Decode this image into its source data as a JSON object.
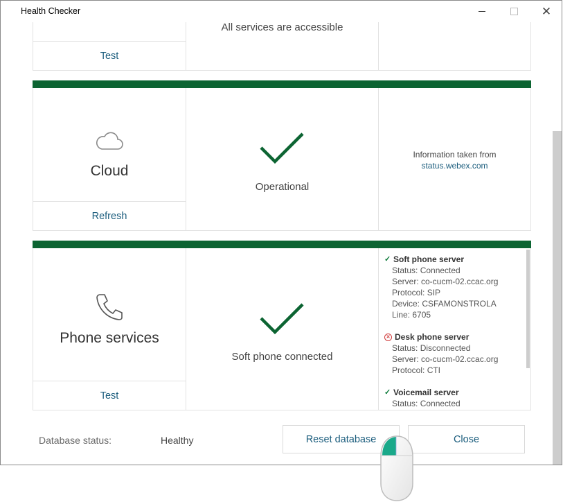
{
  "window": {
    "title": "Health Checker"
  },
  "cards": {
    "top": {
      "status": "All services are accessible",
      "action": "Test"
    },
    "cloud": {
      "name": "Cloud",
      "status": "Operational",
      "action": "Refresh",
      "info_prefix": "Information taken from",
      "info_link": "status.webex.com",
      "icon": "cloud-icon"
    },
    "phone": {
      "name": "Phone services",
      "status": "Soft phone connected",
      "action": "Test",
      "icon": "phone-icon",
      "details": [
        {
          "state": "ok",
          "title": "Soft phone server",
          "lines": [
            "Status: Connected",
            "Server: co-cucm-02.ccac.org",
            "Protocol: SIP",
            "Device: CSFAMONSTROLA",
            "Line: 6705"
          ]
        },
        {
          "state": "error",
          "title": "Desk phone server",
          "lines": [
            "Status: Disconnected",
            "Server: co-cucm-02.ccac.org",
            "Protocol: CTI"
          ]
        },
        {
          "state": "ok",
          "title": "Voicemail server",
          "lines": [
            "Status: Connected"
          ]
        }
      ]
    }
  },
  "footer": {
    "db_label": "Database status:",
    "db_value": "Healthy",
    "reset_label": "Reset database",
    "close_label": "Close"
  },
  "colors": {
    "accent_bar": "#0c6432",
    "link": "#1b5d7d",
    "check": "#0c6432",
    "mouse_accent": "#1aa98a"
  }
}
